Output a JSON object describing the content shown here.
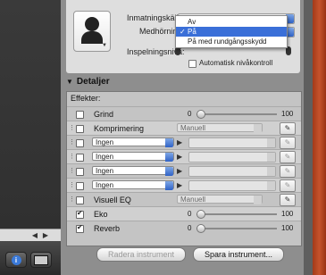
{
  "top": {
    "input_source_label": "Inmatningskälla:",
    "monitoring_label": "Medhörning",
    "input_level_label": "Inspelningsnivå:",
    "auto_level_label": "Automatisk nivåkontroll"
  },
  "monitor_menu": {
    "items": [
      {
        "label": "Av",
        "selected": false
      },
      {
        "label": "På",
        "selected": true
      },
      {
        "label": "På med rundgångsskydd",
        "selected": false
      }
    ]
  },
  "details": {
    "title": "Detaljer",
    "effects_title": "Effekter:",
    "rows": {
      "grind": {
        "label": "Grind",
        "min": "0",
        "max": "100",
        "checked": false,
        "value": 0.0
      },
      "compressor": {
        "label": "Komprimering",
        "preset": "Manuell",
        "checked": false
      },
      "slot1": {
        "value": "Ingen",
        "checked": false
      },
      "slot2": {
        "value": "Ingen",
        "checked": false
      },
      "slot3": {
        "value": "Ingen",
        "checked": false
      },
      "slot4": {
        "value": "Ingen",
        "checked": false
      },
      "visual_eq": {
        "label": "Visuell EQ",
        "preset": "Manuell",
        "checked": false
      },
      "echo": {
        "label": "Eko",
        "min": "0",
        "max": "100",
        "checked": true,
        "value": 0.0
      },
      "reverb": {
        "label": "Reverb",
        "min": "0",
        "max": "100",
        "checked": true,
        "value": 0.0
      }
    }
  },
  "buttons": {
    "delete_instrument": "Radera instrument",
    "save_instrument": "Spara instrument..."
  },
  "colors": {
    "menu_highlight": "#3a6fd8",
    "accent_blue": "#2f62c6"
  }
}
